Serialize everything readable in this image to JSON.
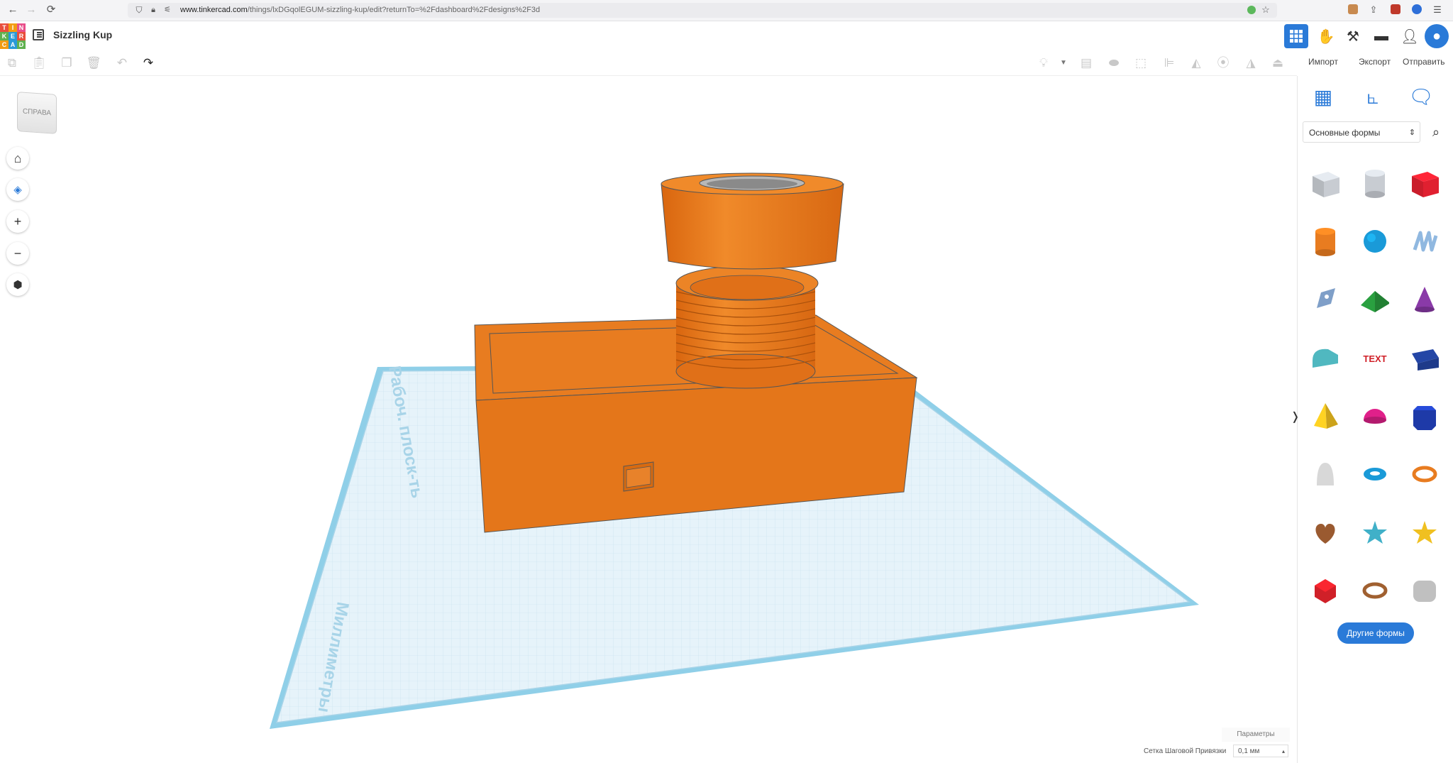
{
  "browser": {
    "url_domain": "www.tinkercad.com",
    "url_path": "/things/lxDGqolEGUM-sizzling-kup/edit?returnTo=%2Fdashboard%2Fdesigns%2F3d"
  },
  "header": {
    "logo_letters": [
      "TIN",
      "KER",
      "CAD"
    ],
    "design_title": "Sizzling Kup"
  },
  "top_buttons": {
    "import": "Импорт",
    "export": "Экспорт",
    "send": "Отправить"
  },
  "viewport": {
    "view_cube_label": "СПРАВА",
    "workplane_label": "Рабоч. плоск-ть",
    "units_label": "Миллиметры",
    "params_label": "Параметры",
    "snap_label": "Сетка Шаговой Привязки",
    "snap_value": "0,1 мм"
  },
  "panel": {
    "category": "Основные формы",
    "more_shapes": "Другие формы",
    "shapes": [
      {
        "name": "box-hole",
        "color": "#c8ccd2"
      },
      {
        "name": "cylinder-hole",
        "color": "#c8ccd2"
      },
      {
        "name": "box",
        "color": "#e02030"
      },
      {
        "name": "cylinder",
        "color": "#e87c20"
      },
      {
        "name": "sphere",
        "color": "#1a9ad8"
      },
      {
        "name": "scribble",
        "color": "#90b8e0"
      },
      {
        "name": "shape-generator",
        "color": "#7f9fc8"
      },
      {
        "name": "roof",
        "color": "#2aa040"
      },
      {
        "name": "cone",
        "color": "#8a3aa8"
      },
      {
        "name": "round-roof",
        "color": "#50b8c0"
      },
      {
        "name": "text",
        "color": "#d02028"
      },
      {
        "name": "wedge",
        "color": "#1e3a8a"
      },
      {
        "name": "pyramid",
        "color": "#f0c020"
      },
      {
        "name": "half-sphere",
        "color": "#e0208a"
      },
      {
        "name": "polygon",
        "color": "#1e3aa8"
      },
      {
        "name": "paraboloid",
        "color": "#d8d8d8"
      },
      {
        "name": "torus",
        "color": "#1a9ad8"
      },
      {
        "name": "tube",
        "color": "#e87c20"
      },
      {
        "name": "heart",
        "color": "#9a5a30"
      },
      {
        "name": "star-teal",
        "color": "#40b0c8"
      },
      {
        "name": "star-yellow",
        "color": "#f0c020"
      },
      {
        "name": "icosahedron",
        "color": "#d02028"
      },
      {
        "name": "ring",
        "color": "#a06030"
      },
      {
        "name": "rounded-box",
        "color": "#c0c0c0"
      }
    ]
  },
  "colors": {
    "accent": "#2a7ad8",
    "model": "#e87c20",
    "workplane": "#e6f3fa"
  }
}
